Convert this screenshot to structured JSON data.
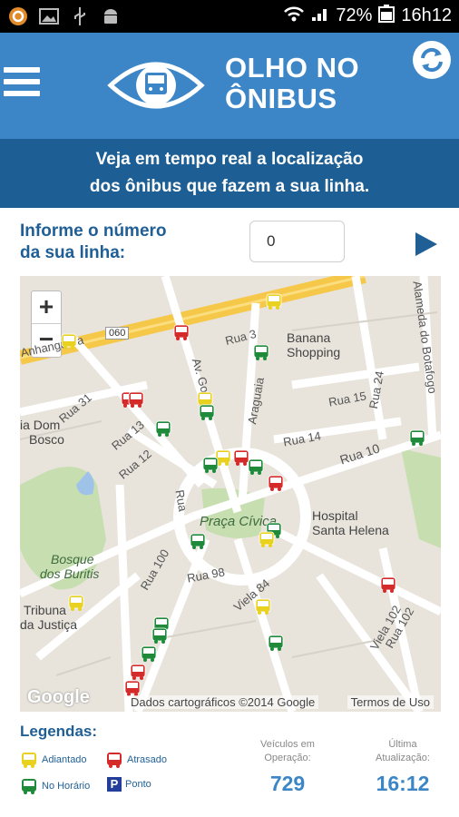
{
  "statusbar": {
    "battery": "72%",
    "time": "16h12"
  },
  "app": {
    "name_line1": "OLHO NO",
    "name_line2": "ÔNIBUS"
  },
  "tagline": {
    "line1": "Veja em tempo real a localização",
    "line2": "dos ônibus que fazem a sua linha."
  },
  "form": {
    "label_line1": "Informe o número",
    "label_line2": "da sua linha:",
    "line_value": "0"
  },
  "map": {
    "zoom_in": "+",
    "zoom_out": "−",
    "labels": {
      "banana_shopping_1": "Banana",
      "banana_shopping_2": "Shopping",
      "praca_civica": "Praça Cívica",
      "hospital_1": "Hospital",
      "hospital_2": "Santa Helena",
      "bosque_1": "Bosque",
      "bosque_2": "dos Buritis",
      "tribuna_1": "Tribuna",
      "tribuna_2": "da Justiça",
      "dom_bosco_1": "ia Dom",
      "dom_bosco_2": "Bosco",
      "anhanguera": "Anhanguera",
      "rua10": "Rua 10",
      "rua3": "Rua 3",
      "rua15": "Rua 15",
      "rua14": "Rua 14",
      "rua24": "Rua 24",
      "rua13": "Rua 13",
      "rua12": "Rua 12",
      "rua31": "Rua 31",
      "rua98": "Rua 98",
      "rua100": "Rua 100",
      "rua102": "Rua 102",
      "viela84": "Viela 84",
      "viela102": "Viela 102",
      "araguaia": "Araguaia",
      "av_goias": "Av. Goiás",
      "alameda": "Alameda do Botafogo",
      "road060": "060",
      "rua": "Rua"
    },
    "google": "Google",
    "attribution": "Dados cartográficos ©2014 Google",
    "terms": "Termos de Uso"
  },
  "legend": {
    "title": "Legendas:",
    "adiantado": "Adiantado",
    "atrasado": "Atrasado",
    "no_horario": "No Horário",
    "ponto": "Ponto",
    "ponto_symbol": "P"
  },
  "stats": {
    "vehicles_label_1": "Veículos em",
    "vehicles_label_2": "Operação:",
    "vehicles_value": "729",
    "update_label_1": "Última",
    "update_label_2": "Atualização:",
    "update_value": "16:12"
  },
  "colors": {
    "header": "#3c86c7",
    "band": "#1d5f94",
    "adiantado": "#e9d21f",
    "atrasado": "#d42a2a",
    "no_horario": "#1e8a3a",
    "ponto": "#233d9a"
  }
}
